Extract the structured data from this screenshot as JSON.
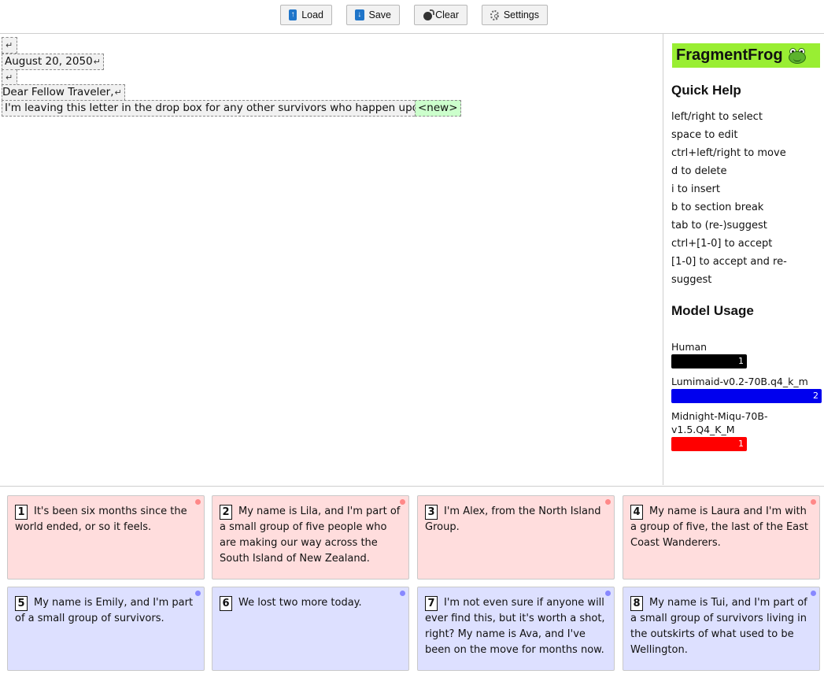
{
  "toolbar": {
    "load_label": "Load",
    "save_label": "Save",
    "clear_label": "Clear",
    "settings_label": "Settings"
  },
  "editor": {
    "fragments": [
      {
        "text": ""
      },
      {
        "text": "August 20, 2050"
      },
      {
        "text": ""
      },
      {
        "text": "Dear Fellow Traveler,"
      },
      {
        "text": "I'm leaving this letter in the drop box for any other survivors who happen upon it."
      },
      {
        "text": "<new>"
      }
    ]
  },
  "sidebar": {
    "logo_text": "FragmentFrog",
    "logo_icon": "frog-icon",
    "quick_help_title": "Quick Help",
    "help_lines": [
      "left/right to select",
      "space to edit",
      "ctrl+left/right to move",
      "d to delete",
      "i to insert",
      "b to section break",
      "tab to (re-)suggest",
      "ctrl+[1-0] to accept",
      "[1-0] to accept and re-",
      "suggest"
    ],
    "model_usage_title": "Model Usage",
    "models": [
      {
        "name": "Human",
        "count": "1",
        "color": "#000000",
        "share": 0.5
      },
      {
        "name": "Lumimaid-v0.2-70B.q4_k_m",
        "count": "2",
        "color": "#0000ee",
        "share": 1.0
      },
      {
        "name": "Midnight-Miqu-70B-v1.5.Q4_K_M",
        "name_line1": "Midnight-Miqu-70B-",
        "name_line2": "v1.5.Q4_K_M",
        "count": "1",
        "color": "#ff0000",
        "share": 0.5
      }
    ]
  },
  "suggestions": [
    {
      "num": "1",
      "text": "It's been six months since the world ended, or so it feels.",
      "tone": "red",
      "dot_color": "#ff8888"
    },
    {
      "num": "2",
      "text": "My name is Lila, and I'm part of a small group of five people who are making our way across the South Island of New Zealand.",
      "tone": "red",
      "dot_color": "#ff8888"
    },
    {
      "num": "3",
      "text": "I'm Alex, from the North Island Group.",
      "tone": "red",
      "dot_color": "#ff8888"
    },
    {
      "num": "4",
      "text": "My name is Laura and I'm with a group of five, the last of the East Coast Wanderers.",
      "tone": "red",
      "dot_color": "#ff8888"
    },
    {
      "num": "5",
      "text": "My name is Emily, and I'm part of a small group of survivors.",
      "tone": "blue",
      "dot_color": "#8888ff"
    },
    {
      "num": "6",
      "text": "We lost two more today.",
      "tone": "blue",
      "dot_color": "#8888ff"
    },
    {
      "num": "7",
      "text": "I'm not even sure if anyone will ever find this, but it's worth a shot, right? My name is Ava, and I've been on the move for months now.",
      "tone": "blue",
      "dot_color": "#8888ff"
    },
    {
      "num": "8",
      "text": "My name is Tui, and I'm part of a small group of survivors living in the outskirts of what used to be Wellington.",
      "tone": "blue",
      "dot_color": "#8888ff"
    }
  ]
}
